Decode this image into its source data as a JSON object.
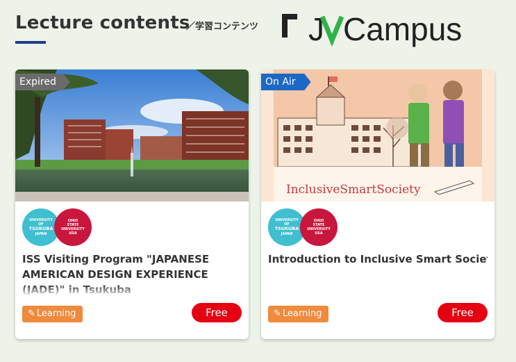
{
  "section": {
    "title": "Lecture contents",
    "subtitle": "／学習コンテンツ",
    "brand": "JV-Campus"
  },
  "cards": [
    {
      "status": "Expired",
      "logos": {
        "left": {
          "line1": "UNIVERSITY",
          "line2": "OF",
          "line3": "TSUKUBA",
          "line4": "JAPAN"
        },
        "right": {
          "line1": "OHIO",
          "line2": "STATE",
          "line3": "UNIVERSITY",
          "line4": "USA"
        }
      },
      "title": "ISS Visiting Program \"JAPANESE AMERICAN DESIGN EXPERIENCE (JADE)\" in Tsukuba",
      "tag": "Learning",
      "price": "Free"
    },
    {
      "status": "On Air",
      "image_caption": "InclusiveSmartSociety",
      "logos": {
        "left": {
          "line1": "UNIVERSITY",
          "line2": "OF",
          "line3": "TSUKUBA",
          "line4": "JAPAN"
        },
        "right": {
          "line1": "OHIO",
          "line2": "STATE",
          "line3": "UNIVERSITY",
          "line4": "USA"
        }
      },
      "title": "Introduction to Inclusive Smart Society I",
      "tag": "Learning",
      "price": "Free"
    }
  ],
  "icons": {
    "tag": "pencil-icon"
  },
  "colors": {
    "background": "#eef3e9",
    "accent_underline": "#1d3c8f",
    "expired_badge": "#6b6b6b",
    "onair_badge": "#1c68c6",
    "learning_tag": "#f08a3c",
    "price_badge": "#e50012",
    "tsukuba_logo": "#3fbfcf",
    "ohio_logo": "#c9163d"
  }
}
